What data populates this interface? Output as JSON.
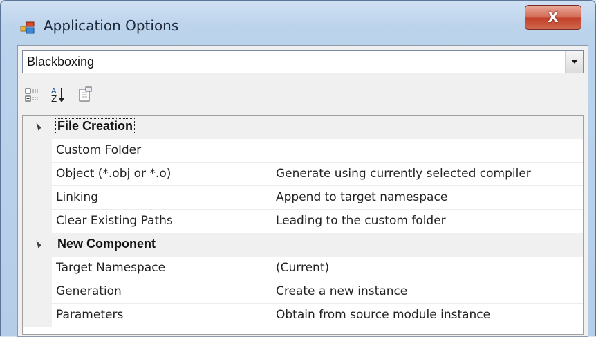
{
  "window": {
    "title": "Application Options",
    "close_glyph": "X",
    "icon": "application-options-icon"
  },
  "combo": {
    "selected": "Blackboxing"
  },
  "toolbar": {
    "buttons": [
      "categorized-icon",
      "alphabetical-sort-icon",
      "property-pages-icon"
    ]
  },
  "grid": {
    "categories": [
      {
        "label": "File Creation",
        "properties": [
          {
            "name": "Custom Folder",
            "value": ""
          },
          {
            "name": "Object (*.obj or *.o)",
            "value": "Generate using currently selected compiler"
          },
          {
            "name": "Linking",
            "value": "Append to target namespace"
          },
          {
            "name": "Clear Existing Paths",
            "value": "Leading to the custom folder"
          }
        ]
      },
      {
        "label": "New Component",
        "properties": [
          {
            "name": "Target Namespace",
            "value": "(Current)"
          },
          {
            "name": "Generation",
            "value": "Create a new instance"
          },
          {
            "name": "Parameters",
            "value": "Obtain from source module instance"
          }
        ]
      }
    ]
  }
}
